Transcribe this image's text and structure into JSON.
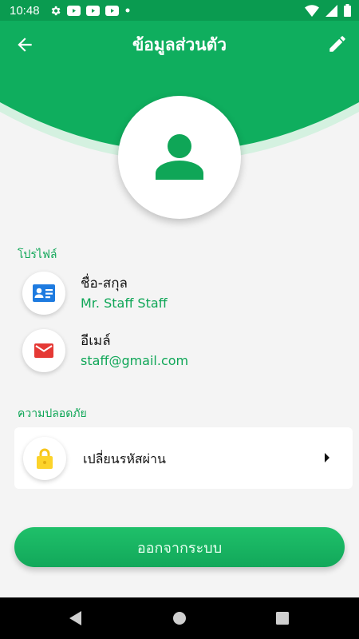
{
  "status_bar": {
    "time": "10:48",
    "icons": [
      "settings-icon",
      "youtube-icon",
      "youtube-icon",
      "youtube-icon",
      "dot-icon",
      "wifi-icon",
      "signal-icon",
      "battery-icon"
    ]
  },
  "header": {
    "title": "ข้อมูลส่วนตัว",
    "back_icon": "arrow-left-icon",
    "edit_icon": "pencil-icon",
    "colors": {
      "primary": "#0fa657",
      "dark": "#0a9b50"
    }
  },
  "profile": {
    "section_title": "โปรไฟล์",
    "name_label": "ชื่อ-สกุล",
    "name_value": "Mr. Staff Staff",
    "email_label": "อีเมล์",
    "email_value": "staff@gmail.com"
  },
  "security": {
    "section_title": "ความปลอดภัย",
    "change_password_label": "เปลี่ยนรหัสผ่าน"
  },
  "logout_label": "ออกจากระบบ",
  "nav": {
    "back": "triangle-back-icon",
    "home": "circle-home-icon",
    "recents": "square-recents-icon"
  }
}
